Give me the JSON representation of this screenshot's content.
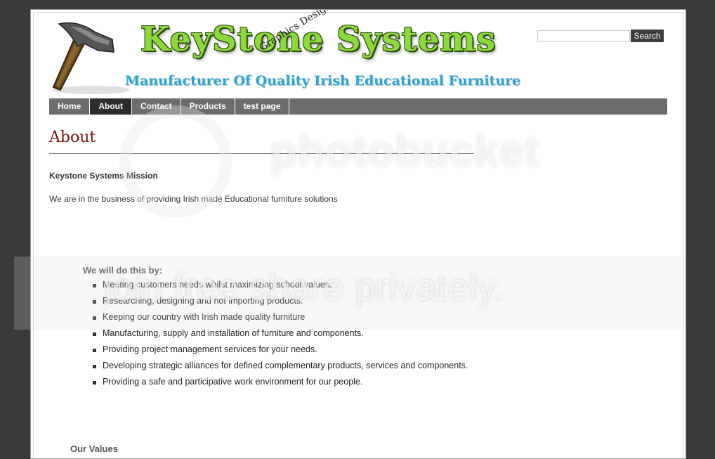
{
  "logo": {
    "title": "KeyStone Systems",
    "subtitle": "Manufacturer Of Quality Irish Educational Furniture",
    "stamp": "Graphics Design"
  },
  "search": {
    "placeholder": "",
    "value": "",
    "button_label": "Search"
  },
  "nav": {
    "items": [
      {
        "label": "Home",
        "active": false
      },
      {
        "label": "About",
        "active": true
      },
      {
        "label": "Contact",
        "active": false
      },
      {
        "label": "Products",
        "active": false
      },
      {
        "label": "test page",
        "active": false
      }
    ]
  },
  "main": {
    "page_title": "About",
    "mission_heading": "Keystone Systems Mission",
    "mission_text": "We are in the business of providing Irish made Educational furniture solutions",
    "will_heading": "We will do this by:",
    "bullets": [
      "Meeting customers needs whilst maximizing school values.",
      "Researching, designing and not importing products.",
      "Keeping our country with Irish made quality furniture",
      "Manufacturing, supply and installation of furniture and components.",
      "Providing project management services for your needs.",
      "Developing strategic alliances for defined complementary products, services and components.",
      "Providing a safe and participative work environment for our people."
    ],
    "values_heading": "Our Values"
  },
  "watermark": {
    "brand": "photobucket",
    "slogan": "join free share privately."
  },
  "colors": {
    "background": "#3a3a3a",
    "nav_bar": "#6d6d6d",
    "nav_active": "#2c2c2c",
    "title_red": "#7a0f0f",
    "logo_green": "#8ed93a",
    "logo_blue": "#2aa5d6"
  },
  "icons": {
    "logo_icon": "hammer-icon"
  }
}
